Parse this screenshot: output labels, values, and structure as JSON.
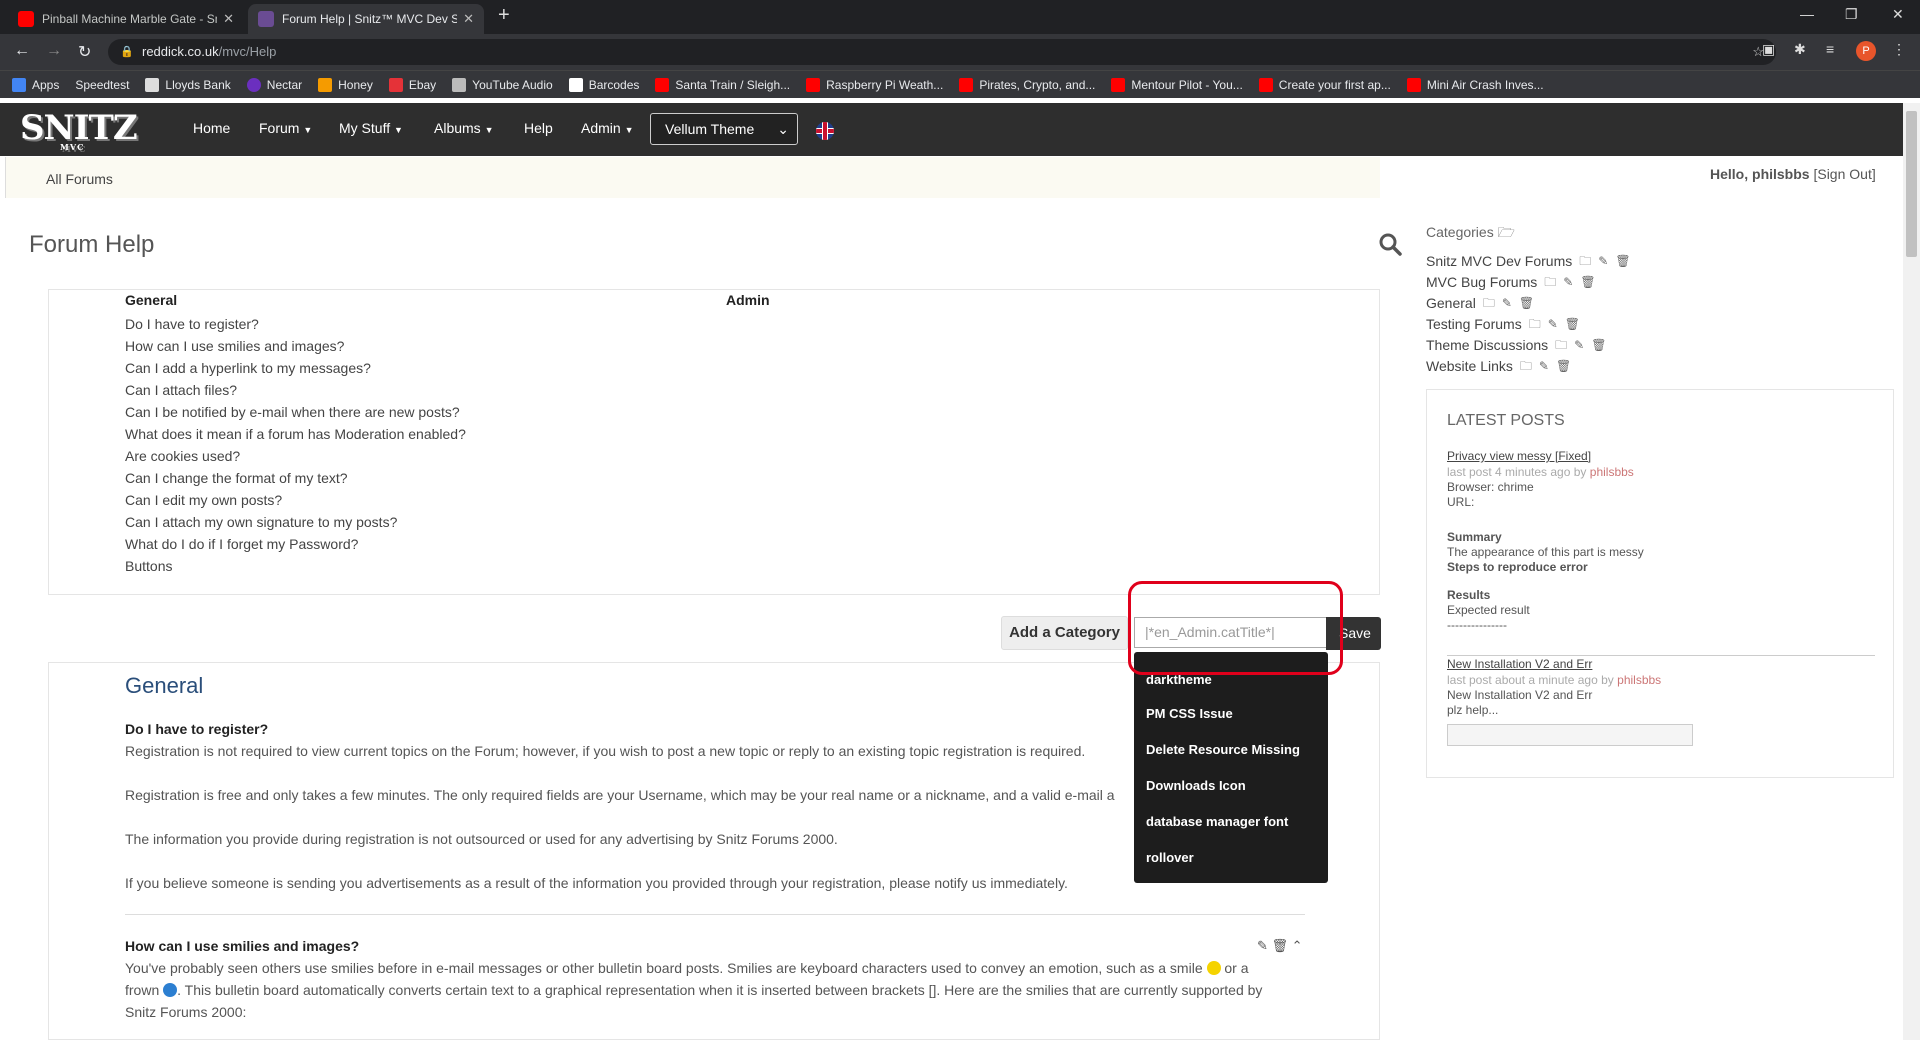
{
  "browser": {
    "tabs": [
      {
        "title": "Pinball Machine Marble Gate - Sn",
        "icon_color": "#ff0000"
      },
      {
        "title": "Forum Help | Snitz™ MVC Dev Sit",
        "icon_color": "#6a4c93"
      }
    ],
    "url_host": "reddick.co.uk",
    "url_path": "/mvc/Help",
    "avatar_letter": "P",
    "bookmarks": [
      "Apps",
      "Speedtest",
      "Lloyds Bank",
      "Nectar",
      "Honey",
      "Ebay",
      "YouTube Audio",
      "Barcodes",
      "Santa Train / Sleigh...",
      "Raspberry Pi Weath...",
      "Pirates, Crypto, and...",
      "Mentour Pilot - You...",
      "Create your first ap...",
      "Mini Air Crash Inves..."
    ]
  },
  "site": {
    "logo_text": "SNITZ",
    "logo_sub": "MVC",
    "nav": [
      "Home",
      "Forum",
      "My Stuff",
      "Albums",
      "Help",
      "Admin"
    ],
    "theme_select": "Vellum Theme",
    "breadcrumb": "All Forums",
    "hello_prefix": "Hello,",
    "username": "philsbbs",
    "signout": "[Sign Out]"
  },
  "page": {
    "title": "Forum Help",
    "col_general": "General",
    "col_admin": "Admin",
    "questions": [
      "Do I have to register?",
      "How can I use smilies and images?",
      "Can I add a hyperlink to my messages?",
      "Can I attach files?",
      "Can I be notified by e-mail when there are new posts?",
      "What does it mean if a forum has Moderation enabled?",
      "Are cookies used?",
      "Can I change the format of my text?",
      "Can I edit my own posts?",
      "Can I attach my own signature to my posts?",
      "What do I do if I forget my Password?",
      "Buttons"
    ],
    "add_category": "Add a Category",
    "cat_input_placeholder": "|*en_Admin.catTitle*|",
    "save": "Save",
    "autocomplete": [
      "darktheme",
      "PM CSS Issue",
      "Delete Resource Missing",
      "Downloads Icon",
      "database manager font",
      "rollover"
    ],
    "section_title": "General",
    "q1_title": "Do I have to register?",
    "q1_p1": "Registration is not required to view current topics on the Forum; however, if you wish to post a new topic or reply to an existing topic registration is required.",
    "q1_p2": "Registration is free and only takes a few minutes. The only required fields are your Username, which may be your real name or a nickname, and a valid e-mail a",
    "q1_p3": "The information you provide during registration is not outsourced or used for any advertising by Snitz Forums 2000.",
    "q1_p4": "If you believe someone is sending you advertisements as a result of the information you provided through your registration, please notify us immediately.",
    "q2_title": "How can I use smilies and images?",
    "q2_p1a": "You've probably seen others use smilies before in e-mail messages or other bulletin board posts. Smilies are keyboard characters used to convey an emotion, such as a smile",
    "q2_p1b": "or a",
    "q2_p2a": "frown",
    "q2_p2b": ". This bulletin board automatically converts certain text to a graphical representation when it is inserted between brackets []. Here are the smilies that are currently supported by",
    "q2_p3": "Snitz Forums 2000:"
  },
  "sidebar": {
    "categories_label": "Categories",
    "categories": [
      "Snitz MVC Dev Forums",
      "MVC Bug Forums",
      "General",
      "Testing Forums",
      "Theme Discussions",
      "Website Links"
    ],
    "latest_title": "LATEST POSTS",
    "post1": {
      "title": "Privacy view messy [Fixed]",
      "meta": "last post 4 minutes ago",
      "by": "by",
      "author": "philsbbs",
      "browser": "Browser: chrime",
      "url": "URL:",
      "summary_h": "Summary",
      "summary": "The appearance of this part is messy",
      "steps_h": "Steps to reproduce error",
      "results_h": "Results",
      "results": "Expected result",
      "dashes": "---------------"
    },
    "post2": {
      "title": "New Installation V2 and Err",
      "meta": "last post about a minute ago",
      "by": "by",
      "author": "philsbbs",
      "line1": "New Installation V2 and Err",
      "line2": "plz help..."
    }
  }
}
